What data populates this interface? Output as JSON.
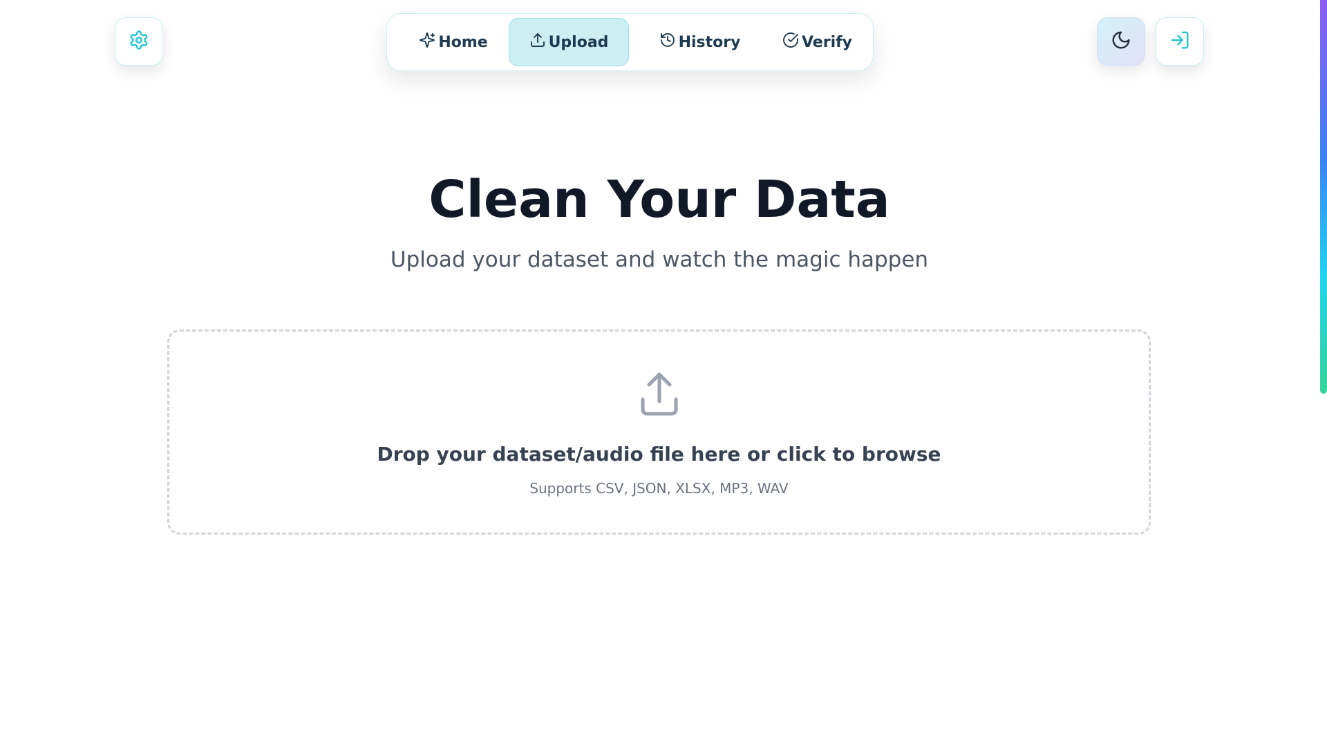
{
  "header": {
    "settings_icon": "gear-icon",
    "theme_icon": "moon-icon",
    "login_icon": "log-in-icon"
  },
  "nav": {
    "active": "Upload",
    "items": [
      {
        "label": "Home",
        "icon": "sparkles-icon"
      },
      {
        "label": "Upload",
        "icon": "upload-icon"
      },
      {
        "label": "History",
        "icon": "history-icon"
      },
      {
        "label": "Verify",
        "icon": "check-circle-icon"
      }
    ]
  },
  "hero": {
    "title": "Clean Your Data",
    "subtitle": "Upload your dataset and watch the magic happen"
  },
  "dropzone": {
    "icon": "upload-icon",
    "title": "Drop your dataset/audio file here or click to browse",
    "formats": "Supports CSV, JSON, XLSX, MP3, WAV"
  },
  "colors": {
    "accent": "#22c3d6",
    "active_tab_bg": "#cdeff4",
    "text_dark": "#111827",
    "text_muted": "#4b5563"
  }
}
